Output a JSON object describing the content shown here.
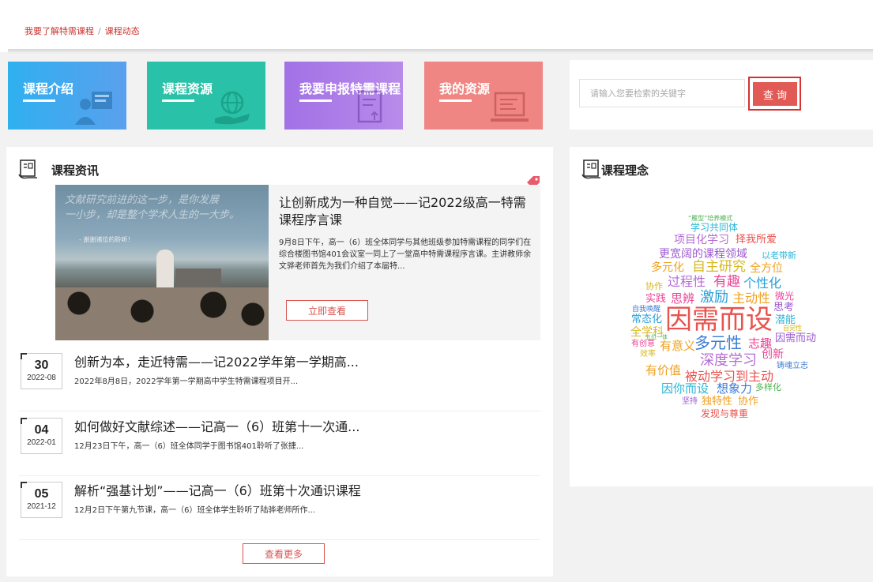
{
  "breadcrumb": {
    "item1": "我要了解特需课程",
    "sep": "/",
    "item2": "课程动态"
  },
  "nav_tiles": [
    {
      "label": "课程介绍",
      "icon": "person-board-icon",
      "color": "#38aaf0"
    },
    {
      "label": "课程资源",
      "icon": "globe-hand-icon",
      "color": "#29c2a8"
    },
    {
      "label": "我要申报特需课程",
      "icon": "document-upload-icon",
      "color": "#a974e7"
    },
    {
      "label": "我的资源",
      "icon": "laptop-document-icon",
      "color": "#ef8683"
    }
  ],
  "search": {
    "placeholder": "请输入您要检索的关键字",
    "button": "查 询"
  },
  "news": {
    "title": "课程资讯",
    "featured": {
      "photo_text_line1": "文献研究前进的这一步，是你发展",
      "photo_text_line2": "一小步，却是整个学术人生的一大步。",
      "photo_caption": "- 谢谢诸位的聆听！",
      "title": "让创新成为一种自觉——记2022级高一特需课程序言课",
      "desc": "9月8日下午，高一（6）班全体同学与其他班级参加特需课程的同学们在综合楼图书馆401会议室一同上了一堂高中特需课程序言课。主讲教师余文骅老师首先为我们介绍了本届特...",
      "button": "立即查看"
    },
    "items": [
      {
        "day": "30",
        "ym": "2022-08",
        "title": "创新为本，走近特需——记2022学年第一学期高...",
        "desc": "2022年8月8日，2022学年第一学期高中学生特需课程项目开..."
      },
      {
        "day": "04",
        "ym": "2022-01",
        "title": "如何做好文献综述——记高一（6）班第十一次通...",
        "desc": "12月23日下午，高一（6）班全体同学于图书馆401聆听了张捷..."
      },
      {
        "day": "05",
        "ym": "2021-12",
        "title": "解析“强基计划”——记高一（6）班第十次通识课程",
        "desc": "12月2日下午第九节课，高一（6）班全体学生聆听了陆骅老师所作..."
      }
    ],
    "more_button": "查看更多"
  },
  "concept": {
    "title": "课程理念",
    "words": [
      {
        "text": "“雁型”培养模式",
        "color": "#4caf50"
      },
      {
        "text": "学习共同体",
        "color": "#29b6d8"
      },
      {
        "text": "项目化学习",
        "color": "#b56bd6"
      },
      {
        "text": "择我所爱",
        "color": "#e8534f"
      },
      {
        "text": "更宽阔的课程领域",
        "color": "#9b59d0"
      },
      {
        "text": "以老带新",
        "color": "#29b6d8"
      },
      {
        "text": "多元化",
        "color": "#f0a020"
      },
      {
        "text": "自主研究",
        "color": "#d6b820"
      },
      {
        "text": "全方位",
        "color": "#f0a020"
      },
      {
        "text": "协作",
        "color": "#d6b820"
      },
      {
        "text": "过程性",
        "color": "#b56bd6"
      },
      {
        "text": "有趣",
        "color": "#e84393"
      },
      {
        "text": "个性化",
        "color": "#29a0d8"
      },
      {
        "text": "实践",
        "color": "#e84393"
      },
      {
        "text": "思辨",
        "color": "#e84393"
      },
      {
        "text": "激励",
        "color": "#29a0d8"
      },
      {
        "text": "主动性",
        "color": "#f0a020"
      },
      {
        "text": "微光",
        "color": "#e84393"
      },
      {
        "text": "自我唤醒",
        "color": "#3a7bd5"
      },
      {
        "text": "思考",
        "color": "#9b59d0"
      },
      {
        "text": "常态化",
        "color": "#29a0d8"
      },
      {
        "text": "因需而设",
        "color": "#e8534f"
      },
      {
        "text": "自觉性",
        "color": "#d6b820"
      },
      {
        "text": "潜能",
        "color": "#29b6d8"
      },
      {
        "text": "全学科",
        "color": "#d6b820"
      },
      {
        "text": "五位一体",
        "color": "#4caf50"
      },
      {
        "text": "有创意",
        "color": "#e84393"
      },
      {
        "text": "有意义",
        "color": "#f0a020"
      },
      {
        "text": "多元性",
        "color": "#3a7bd5"
      },
      {
        "text": "志趣",
        "color": "#e84393"
      },
      {
        "text": "因需而动",
        "color": "#9b59d0"
      },
      {
        "text": "效率",
        "color": "#d6b820"
      },
      {
        "text": "深度学习",
        "color": "#b56bd6"
      },
      {
        "text": "创新",
        "color": "#e84393"
      },
      {
        "text": "有价值",
        "color": "#f0a020"
      },
      {
        "text": "被动学习到主动",
        "color": "#e8534f"
      },
      {
        "text": "铸魂立志",
        "color": "#3a7bd5"
      },
      {
        "text": "因你而设",
        "color": "#29b6d8"
      },
      {
        "text": "想象力",
        "color": "#3a7bd5"
      },
      {
        "text": "多样化",
        "color": "#4caf50"
      },
      {
        "text": "坚持",
        "color": "#9b59d0"
      },
      {
        "text": "独特性",
        "color": "#f0a020"
      },
      {
        "text": "协作",
        "color": "#f0a020"
      },
      {
        "text": "发现与尊重",
        "color": "#e8534f"
      }
    ]
  }
}
